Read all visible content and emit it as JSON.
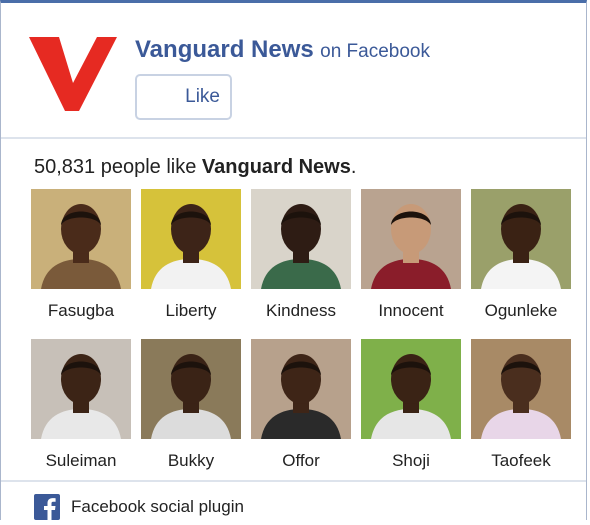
{
  "header": {
    "page_name": "Vanguard News",
    "on_text": "on Facebook",
    "like_label": "Like",
    "logo_letter": "V",
    "brand_color": "#e62a22"
  },
  "summary": {
    "count": "50,831",
    "prefix_text": "people like",
    "page_name": "Vanguard News",
    "suffix": "."
  },
  "fans": [
    {
      "name": "Fasugba",
      "bg": "#c9b07a",
      "skin": "#4a2b1a",
      "shirt": "#7a5a3a"
    },
    {
      "name": "Liberty",
      "bg": "#d6c23a",
      "skin": "#3d2418",
      "shirt": "#f2f2f2"
    },
    {
      "name": "Kindness",
      "bg": "#d9d4ca",
      "skin": "#2e1c14",
      "shirt": "#3a6a4a"
    },
    {
      "name": "Innocent",
      "bg": "#b9a390",
      "skin": "#c79a78",
      "shirt": "#8a1d2a"
    },
    {
      "name": "Ogunleke",
      "bg": "#9aa06a",
      "skin": "#3a2214",
      "shirt": "#f4f4f4"
    },
    {
      "name": "Suleiman",
      "bg": "#c7c0b8",
      "skin": "#3c2416",
      "shirt": "#e8e8e8"
    },
    {
      "name": "Bukky",
      "bg": "#8a7a5a",
      "skin": "#3a2316",
      "shirt": "#dcdcdc"
    },
    {
      "name": "Offor",
      "bg": "#b7a18c",
      "skin": "#3e2517",
      "shirt": "#2a2a2a"
    },
    {
      "name": "Shoji",
      "bg": "#7fb04a",
      "skin": "#3a2315",
      "shirt": "#e6e6e6"
    },
    {
      "name": "Taofeek",
      "bg": "#a88a66",
      "skin": "#4a2e1e",
      "shirt": "#e8d6e8"
    }
  ],
  "footer": {
    "text": "Facebook social plugin",
    "icon": "facebook-icon",
    "icon_color": "#3b5998"
  }
}
